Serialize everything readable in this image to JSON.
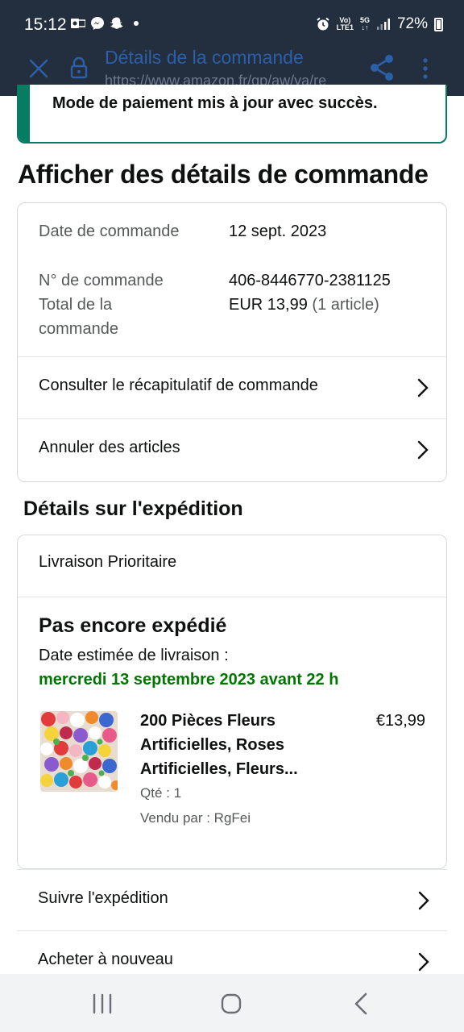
{
  "status_bar": {
    "time": "15:12",
    "network_top": "Vo)",
    "network_bottom": "LTE1",
    "gen_top": "5G",
    "gen_bottom": "↓↑",
    "battery": "72%",
    "icons": [
      "outlook-icon",
      "messenger-icon",
      "snapchat-icon",
      "dot-icon",
      "alarm-icon",
      "signal-icon",
      "battery-icon"
    ]
  },
  "toolbar": {
    "title": "Détails de la commande",
    "url": "https://www.amazon.fr/gp/aw/ya/re"
  },
  "alert": {
    "message": "Mode de paiement mis à jour avec succès."
  },
  "page": {
    "title": "Afficher des détails de commande"
  },
  "order_summary": {
    "date_label": "Date de commande",
    "date_value": "12 sept. 2023",
    "number_label": "N° de commande",
    "number_value": "406-8446770-2381125",
    "total_label": "Total de la commande",
    "total_value": "EUR 13,99",
    "total_items": "(1 article)",
    "links": [
      "Consulter le récapitulatif de commande",
      "Annuler des articles"
    ]
  },
  "shipping": {
    "section_title": "Détails sur l'expédition",
    "method": "Livraison Prioritaire",
    "status": "Pas encore expédié",
    "eta_label": "Date estimée de livraison :",
    "eta_date": "mercredi 13 septembre 2023 avant 22 h",
    "product": {
      "title": "200 Pièces Fleurs Artificielles, Roses Artificielles, Fleurs...",
      "price": "€13,99",
      "quantity": "Qté : 1",
      "seller": "Vendu par : RgFei"
    }
  },
  "actions": [
    "Suivre l'expédition",
    "Acheter à nouveau"
  ],
  "colors": {
    "header_bg": "#232f3e",
    "success_green": "#067d62",
    "eta_green": "#007600",
    "link_title_blue": "#2b5fa8"
  }
}
